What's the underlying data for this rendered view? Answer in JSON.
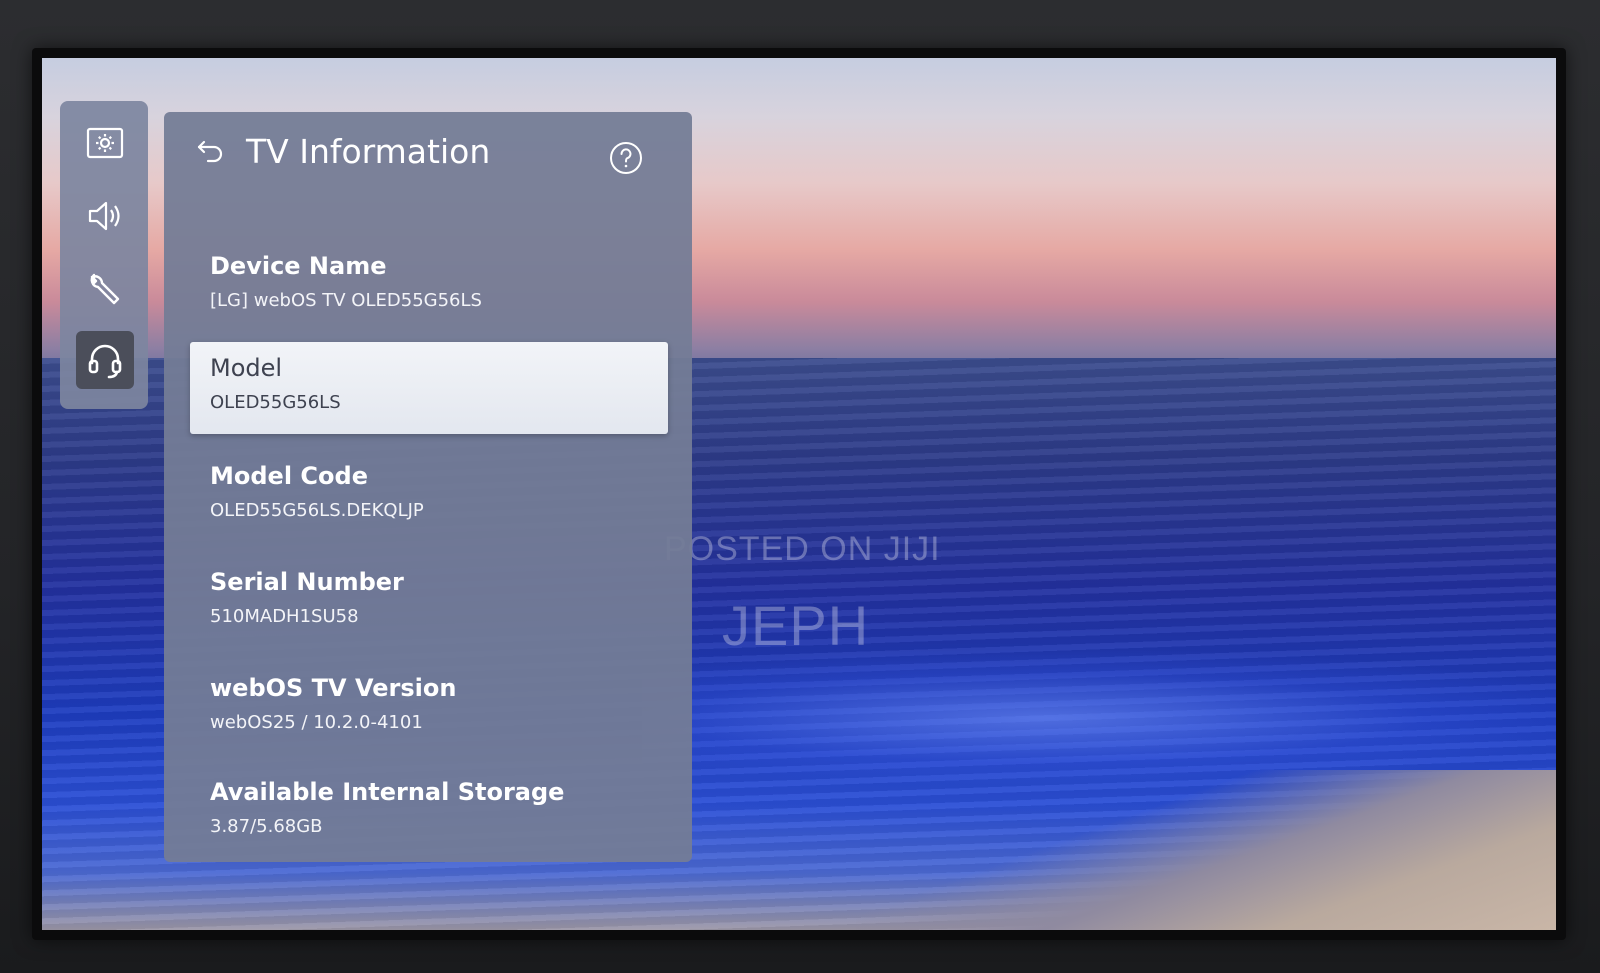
{
  "watermark": {
    "line1": "POSTED ON JIJI",
    "line2": "JEPH"
  },
  "rail": {
    "items": [
      {
        "icon": "picture-icon",
        "selected": false
      },
      {
        "icon": "sound-icon",
        "selected": false
      },
      {
        "icon": "wrench-icon",
        "selected": false
      },
      {
        "icon": "headset-icon",
        "selected": true
      }
    ]
  },
  "panel": {
    "title": "TV Information",
    "back_icon": "back-arrow-icon",
    "help_icon": "help-icon",
    "items": [
      {
        "label": "Device Name",
        "value": "[LG] webOS TV OLED55G56LS",
        "focused": false
      },
      {
        "label": "Model",
        "value": "OLED55G56LS",
        "focused": true
      },
      {
        "label": "Model Code",
        "value": "OLED55G56LS.DEKQLJP",
        "focused": false
      },
      {
        "label": "Serial Number",
        "value": "510MADH1SU58",
        "focused": false
      },
      {
        "label": "webOS TV Version",
        "value": "webOS25 / 10.2.0-4101",
        "focused": false
      },
      {
        "label": "Available Internal Storage",
        "value": "3.87/5.68GB",
        "focused": false
      }
    ]
  },
  "colors": {
    "panel_bg": "#747c96",
    "focus_bg": "#eef1f6",
    "text_primary": "#ffffff",
    "text_focused": "#3e4250"
  }
}
